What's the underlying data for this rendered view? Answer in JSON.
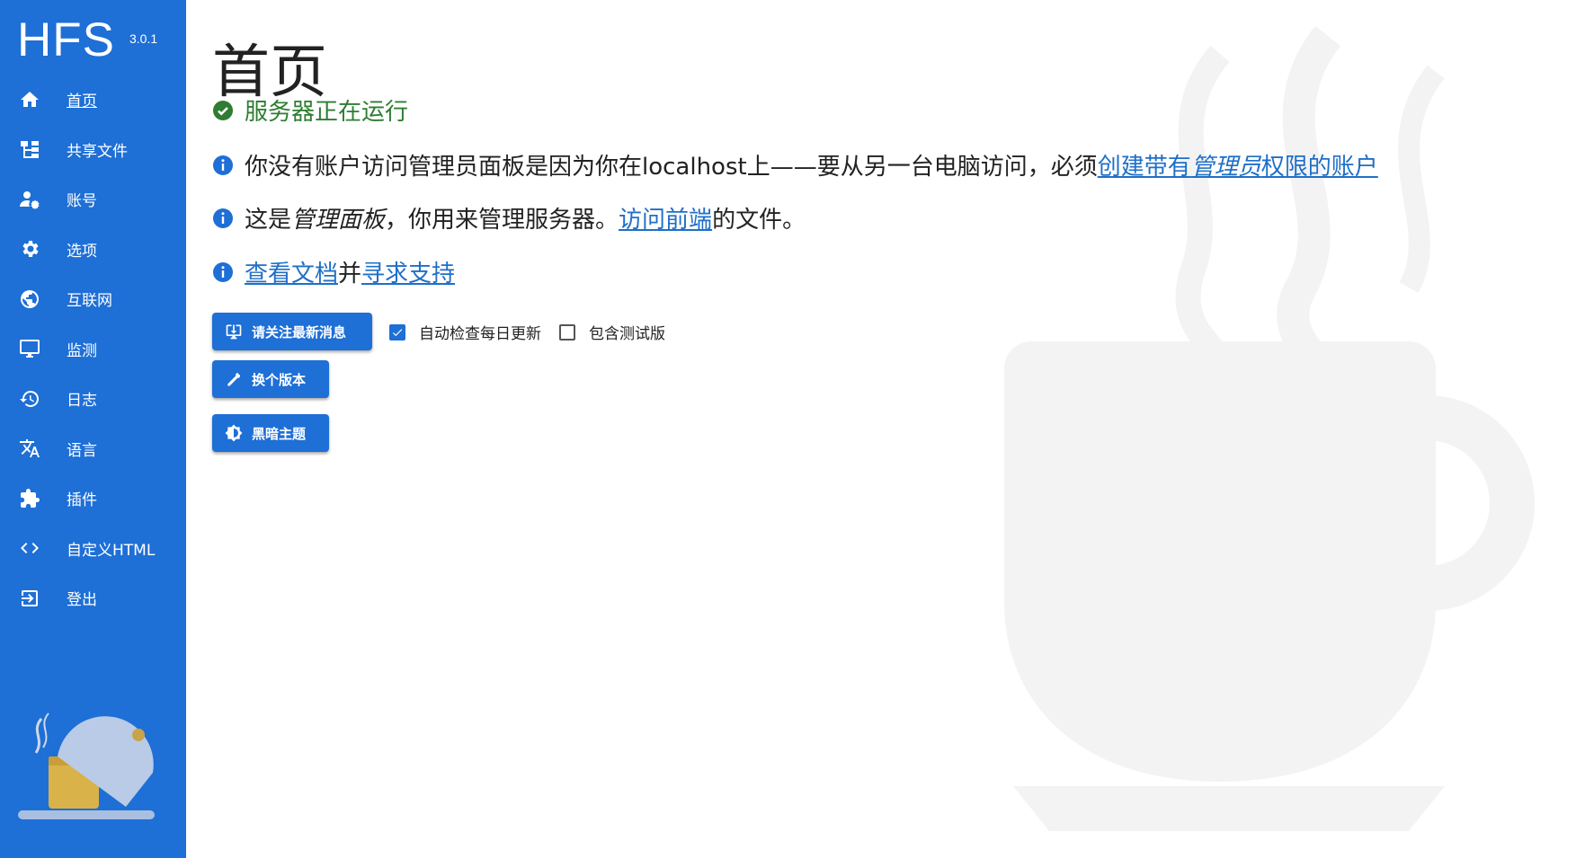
{
  "app": {
    "title": "HFS",
    "version": "3.0.1"
  },
  "sidebar": {
    "items": [
      {
        "label": "首页",
        "icon": "home-icon",
        "active": true
      },
      {
        "label": "共享文件",
        "icon": "tree-icon"
      },
      {
        "label": "账号",
        "icon": "account-settings-icon"
      },
      {
        "label": "选项",
        "icon": "gear-icon"
      },
      {
        "label": "互联网",
        "icon": "globe-icon"
      },
      {
        "label": "监测",
        "icon": "monitor-icon"
      },
      {
        "label": "日志",
        "icon": "history-icon"
      },
      {
        "label": "语言",
        "icon": "translate-icon"
      },
      {
        "label": "插件",
        "icon": "puzzle-icon"
      },
      {
        "label": "自定义HTML",
        "icon": "code-icon"
      },
      {
        "label": "登出",
        "icon": "logout-icon"
      }
    ]
  },
  "main": {
    "title": "首页",
    "status": "服务器正在运行",
    "info1": {
      "text": "你没有账户访问管理员面板是因为你在localhost上——要从另一台电脑访问，必须",
      "link_a": "创建带有",
      "link_b": "管理员",
      "link_c": "权限的账户"
    },
    "info2": {
      "prefix": "这是",
      "emph": "管理面板",
      "middle": "，你用来管理服务器。",
      "link": "访问前端",
      "suffix": "的文件。"
    },
    "info3": {
      "link1": "查看文档",
      "middle": "并",
      "link2": "寻求支持"
    },
    "buttons": {
      "news": "请关注最新消息",
      "version": "换个版本",
      "theme": "黑暗主题"
    },
    "checkboxes": {
      "auto_update": {
        "label": "自动检查每日更新",
        "checked": true
      },
      "beta": {
        "label": "包含测试版",
        "checked": false
      }
    }
  },
  "colors": {
    "sidebar": "#1e6fd6",
    "accent": "#1e6fd6",
    "success": "#2e7d32",
    "link": "#1f6fc8"
  }
}
